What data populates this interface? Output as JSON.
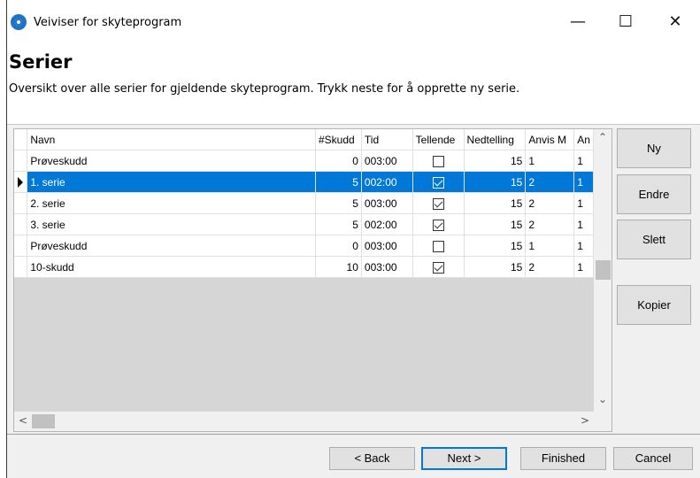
{
  "window": {
    "title": "Veiviser for skyteprogram",
    "minimize": "—",
    "maximize": "☐",
    "close": "✕"
  },
  "page": {
    "heading": "Serier",
    "description": "Oversikt over alle serier for gjeldende skyteprogram. Trykk neste for å opprette ny serie."
  },
  "grid": {
    "columns": [
      "Navn",
      "#Skudd",
      "Tid",
      "Tellende",
      "Nedtelling",
      "Anvis M",
      "An"
    ],
    "rows": [
      {
        "navn": "Prøveskudd",
        "skudd": "0",
        "tid": "003:00",
        "tellende": false,
        "nedtelling": "15",
        "anvis": "1",
        "an": "1",
        "selected": false
      },
      {
        "navn": "1. serie",
        "skudd": "5",
        "tid": "002:00",
        "tellende": true,
        "nedtelling": "15",
        "anvis": "2",
        "an": "1",
        "selected": true
      },
      {
        "navn": "2. serie",
        "skudd": "5",
        "tid": "003:00",
        "tellende": true,
        "nedtelling": "15",
        "anvis": "2",
        "an": "1",
        "selected": false
      },
      {
        "navn": "3. serie",
        "skudd": "5",
        "tid": "002:00",
        "tellende": true,
        "nedtelling": "15",
        "anvis": "2",
        "an": "1",
        "selected": false
      },
      {
        "navn": "Prøveskudd",
        "skudd": "0",
        "tid": "003:00",
        "tellende": false,
        "nedtelling": "15",
        "anvis": "1",
        "an": "1",
        "selected": false
      },
      {
        "navn": "10-skudd",
        "skudd": "10",
        "tid": "003:00",
        "tellende": true,
        "nedtelling": "15",
        "anvis": "2",
        "an": "1",
        "selected": false
      }
    ]
  },
  "side_buttons": {
    "ny": "Ny",
    "endre": "Endre",
    "slett": "Slett",
    "kopier": "Kopier"
  },
  "footer": {
    "back": "< Back",
    "next": "Next >",
    "finished": "Finished",
    "cancel": "Cancel"
  },
  "colors": {
    "selection": "#0078d7",
    "panel": "#f0f0f0",
    "button": "#e1e1e1"
  }
}
